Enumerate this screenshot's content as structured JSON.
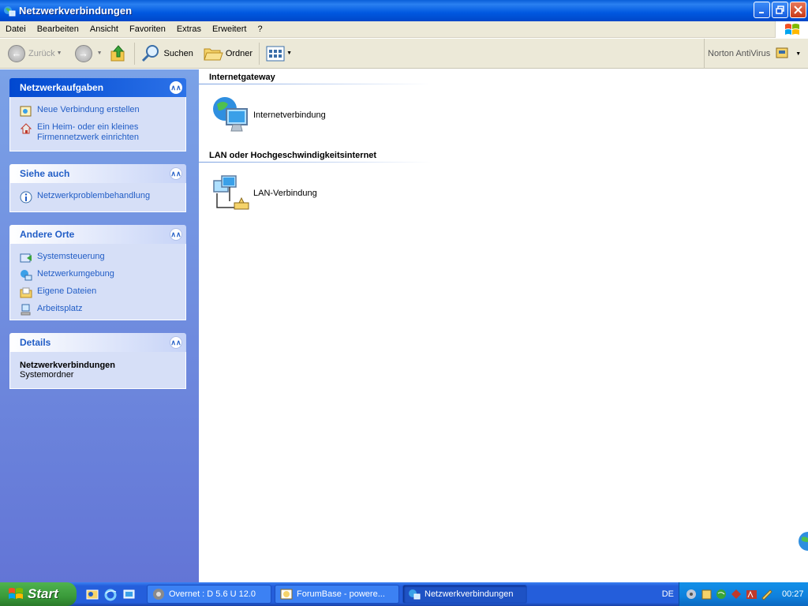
{
  "window": {
    "title": "Netzwerkverbindungen"
  },
  "menu": [
    "Datei",
    "Bearbeiten",
    "Ansicht",
    "Favoriten",
    "Extras",
    "Erweitert",
    "?"
  ],
  "toolbar": {
    "back_label": "Zurück",
    "search_label": "Suchen",
    "folders_label": "Ordner",
    "norton_label": "Norton AntiVirus"
  },
  "left": {
    "network_tasks": {
      "title": "Netzwerkaufgaben",
      "items": [
        "Neue Verbindung erstellen",
        "Ein Heim- oder ein kleines Firmennetzwerk einrichten"
      ]
    },
    "see_also": {
      "title": "Siehe auch",
      "items": [
        "Netzwerkproblembehandlung"
      ]
    },
    "other_places": {
      "title": "Andere Orte",
      "items": [
        "Systemsteuerung",
        "Netzwerkumgebung",
        "Eigene Dateien",
        "Arbeitsplatz"
      ]
    },
    "details": {
      "title": "Details",
      "name": "Netzwerkverbindungen",
      "type": "Systemordner"
    }
  },
  "groups": [
    {
      "title": "Internetgateway",
      "items": [
        "Internetverbindung"
      ]
    },
    {
      "title": "LAN oder Hochgeschwindigkeitsinternet",
      "items": [
        "LAN-Verbindung"
      ]
    }
  ],
  "taskbar": {
    "start_label": "Start",
    "windows": [
      "Overnet : D 5.6 U 12.0",
      "ForumBase - powere...",
      "Netzwerkverbindungen"
    ],
    "language": "DE",
    "clock": "00:27"
  },
  "colors": {
    "titlebar": "#0058e0",
    "link": "#215dc6",
    "panel": "#d6dff7",
    "start": "#3a9a3a"
  }
}
